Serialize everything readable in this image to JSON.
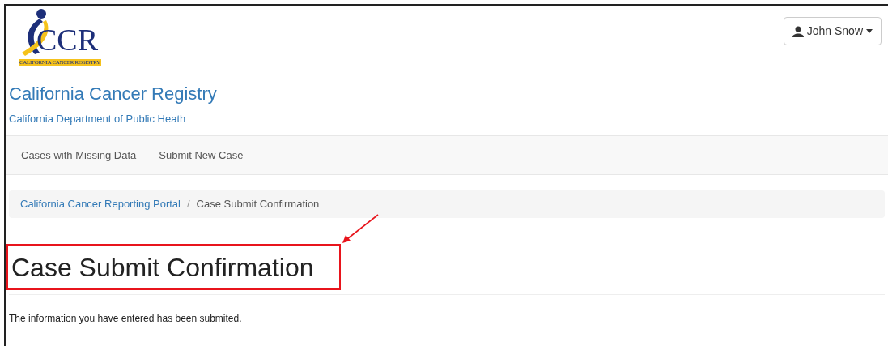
{
  "logo": {
    "letters": "CCR",
    "band": "CALIFORNIA CANCER REGISTRY"
  },
  "user_menu": {
    "label": "John Snow"
  },
  "brand": {
    "title": "California Cancer Registry",
    "subtitle": "California Department of Public Heath"
  },
  "nav": [
    {
      "label": "Cases with Missing Data"
    },
    {
      "label": "Submit New Case"
    }
  ],
  "breadcrumb": [
    {
      "label": "California Cancer Reporting Portal",
      "kind": "link"
    },
    {
      "label": "Case Submit Confirmation",
      "kind": "current"
    }
  ],
  "breadcrumb_separator": "/",
  "heading": "Case Submit Confirmation",
  "message": "The information you have entered has been submited."
}
